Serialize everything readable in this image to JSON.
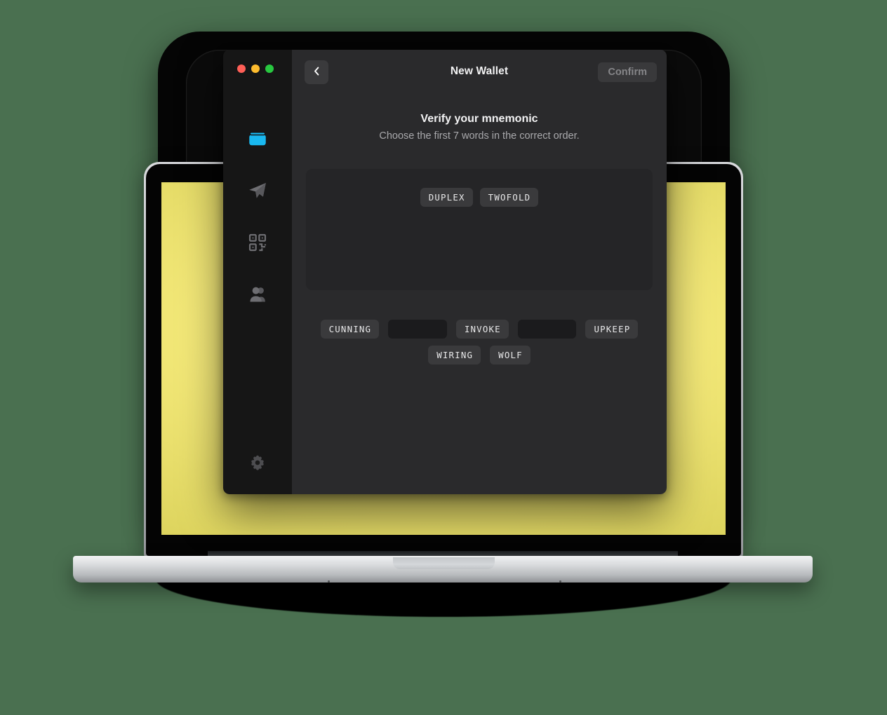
{
  "background": {
    "color": "#4a7050"
  },
  "device": {
    "screen_color": "#f3e878",
    "frame_color": "#c9ccd0"
  },
  "window": {
    "traffic_lights": [
      {
        "name": "close",
        "color": "#ff5f57"
      },
      {
        "name": "minimize",
        "color": "#febc2e"
      },
      {
        "name": "zoom",
        "color": "#28c840"
      }
    ],
    "title": "New Wallet",
    "back_label": "‹",
    "confirm_label": "Confirm",
    "confirm_disabled": true
  },
  "sidebar": {
    "items": [
      {
        "icon": "wallet-icon",
        "active": true,
        "color": "#19b8f0"
      },
      {
        "icon": "send-icon",
        "active": false,
        "color": "#6e6e72"
      },
      {
        "icon": "qr-code-icon",
        "active": false,
        "color": "#6e6e72"
      },
      {
        "icon": "contacts-icon",
        "active": false,
        "color": "#6e6e72"
      }
    ],
    "bottom_item": {
      "icon": "gear-icon",
      "color": "#4d4d50"
    }
  },
  "main": {
    "heading": "Verify your mnemonic",
    "subheading": "Choose the first 7 words in the correct order.",
    "selected_words": [
      "DUPLEX",
      "TWOFOLD"
    ],
    "word_bank": [
      {
        "label": "CUNNING",
        "state": "available"
      },
      {
        "label": "",
        "state": "empty"
      },
      {
        "label": "INVOKE",
        "state": "available"
      },
      {
        "label": "",
        "state": "empty"
      },
      {
        "label": "UPKEEP",
        "state": "available"
      },
      {
        "label": "WIRING",
        "state": "available"
      },
      {
        "label": "WOLF",
        "state": "available"
      }
    ]
  }
}
